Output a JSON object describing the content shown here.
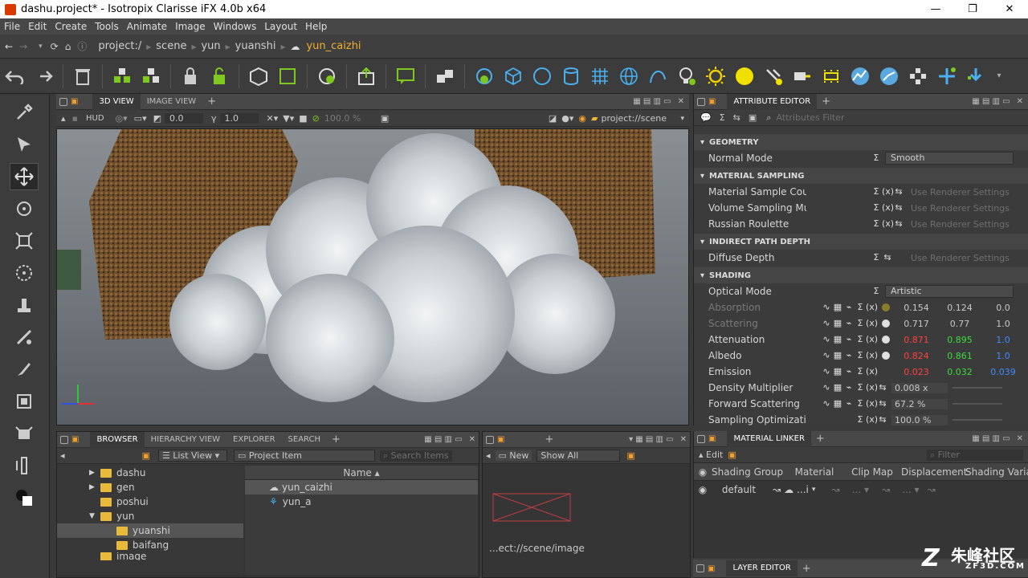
{
  "window": {
    "title": "dashu.project* - Isotropix Clarisse iFX 4.0b x64",
    "minimize_icon": "minimize-icon",
    "maximize_icon": "restore-icon",
    "close_icon": "close-icon"
  },
  "menu": [
    "File",
    "Edit",
    "Create",
    "Tools",
    "Animate",
    "Image",
    "Windows",
    "Layout",
    "Help"
  ],
  "path": {
    "items": [
      "project:/",
      "scene",
      "yun",
      "yuanshi"
    ],
    "current": "yun_caizhi"
  },
  "viewport": {
    "tabs": [
      "3D VIEW",
      "IMAGE VIEW"
    ],
    "hud": "HUD",
    "field1": "0.0",
    "field2": "1.0",
    "percent": "100.0 %",
    "scene_path": "project://scene"
  },
  "attribute_editor": {
    "tab": "ATTRIBUTE EDITOR",
    "filter_placeholder": "Attributes Filter",
    "geometry": {
      "header": "GEOMETRY",
      "normal_mode_label": "Normal Mode",
      "normal_mode_value": "Smooth"
    },
    "material_sampling": {
      "header": "MATERIAL SAMPLING",
      "rows": [
        {
          "label": "Material Sample Count",
          "value": "Use Renderer Settings"
        },
        {
          "label": "Volume Sampling Multiplier",
          "value": "Use Renderer Settings"
        },
        {
          "label": "Russian Roulette",
          "value": "Use Renderer Settings"
        }
      ]
    },
    "indirect": {
      "header": "INDIRECT PATH DEPTH",
      "rows": [
        {
          "label": "Diffuse Depth",
          "value": "Use Renderer Settings"
        }
      ]
    },
    "shading": {
      "header": "SHADING",
      "optical_mode_label": "Optical Mode",
      "optical_mode_value": "Artistic",
      "colors": [
        {
          "label": "Absorption",
          "dim": true,
          "dot": "#8b7d2a",
          "r": "0.154",
          "g": "0.124",
          "b": "0.0",
          "rc": "#c8c8c8",
          "gc": "#c8c8c8",
          "bc": "#c8c8c8"
        },
        {
          "label": "Scattering",
          "dim": true,
          "dot": "#e0e0e0",
          "r": "0.717",
          "g": "0.77",
          "b": "1.0",
          "rc": "#c8c8c8",
          "gc": "#c8c8c8",
          "bc": "#c8c8c8"
        },
        {
          "label": "Attenuation",
          "dim": false,
          "dot": "#e0e0e0",
          "r": "0.871",
          "g": "0.895",
          "b": "1.0",
          "rc": "#ff4040",
          "gc": "#3cdc3c",
          "bc": "#3c8cff"
        },
        {
          "label": "Albedo",
          "dim": false,
          "dot": "#e0e0e0",
          "r": "0.824",
          "g": "0.861",
          "b": "1.0",
          "rc": "#ff4040",
          "gc": "#3cdc3c",
          "bc": "#3c8cff"
        },
        {
          "label": "Emission",
          "dim": false,
          "dot": "",
          "r": "0.023",
          "g": "0.032",
          "b": "0.039",
          "rc": "#ff4040",
          "gc": "#3cdc3c",
          "bc": "#3c8cff"
        }
      ],
      "scalars": [
        {
          "label": "Density Multiplier",
          "value": "0.008 x"
        },
        {
          "label": "Forward Scattering",
          "value": "67.2 %"
        },
        {
          "label": "Sampling Optimization",
          "value": "100.0 %"
        }
      ]
    }
  },
  "browser": {
    "tabs": [
      "BROWSER",
      "HIERARCHY VIEW",
      "EXPLORER",
      "SEARCH"
    ],
    "view_mode": "List View",
    "item_type": "Project Item",
    "search_placeholder": "Search Items",
    "tree": [
      "dashu",
      "gen",
      "poshui",
      "yun",
      "yuanshi",
      "baifang",
      "image"
    ],
    "column": "Name",
    "items": [
      "yun_caizhi",
      "yun_a"
    ]
  },
  "image_panel": {
    "new_label": "New",
    "show": "Show All",
    "path": "...ect://scene/image"
  },
  "material_linker": {
    "tab": "MATERIAL LINKER",
    "edit": "Edit",
    "filter_placeholder": "Filter",
    "columns": [
      "Shading Group",
      "Material",
      "Clip Map",
      "Displacement",
      "Shading Variab"
    ],
    "row": {
      "group": "default",
      "material": "...i"
    }
  },
  "layer_editor": {
    "tab": "LAYER EDITOR"
  },
  "watermark": "朱峰社区",
  "watermark_sub": "ZF3D.COM"
}
